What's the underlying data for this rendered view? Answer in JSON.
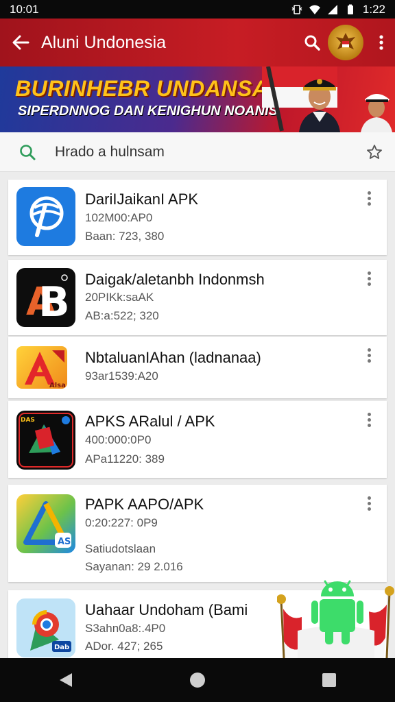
{
  "status_bar": {
    "time": "10:01",
    "clock": "1:22"
  },
  "app_bar": {
    "title": "Aluni Undonesia"
  },
  "banner": {
    "headline": "BURINHEBR UNDANSA!",
    "subtitle": "SIPERDNNOG DAN KENIGHUN NOANIS"
  },
  "search": {
    "text": "Hrado a hulnsam"
  },
  "apps": [
    {
      "name": "DariIJaikanI APK",
      "meta1": "102M00:AP0",
      "meta2": "Baan: 723, 380"
    },
    {
      "name": "Daigak/aletanbh Indonmsh",
      "meta1": "20PIKk:saAK",
      "meta2": "AB:a:522; 320"
    },
    {
      "name": "NbtaluanIAhan (ladnanaa)",
      "meta1": "93ar1539:A20"
    },
    {
      "name": "APKS ARalul / APK",
      "meta1": "400:000:0P0",
      "meta2": "APa11220: 389"
    },
    {
      "name": "PAPK AAPO/APK",
      "meta1": "0:20:227: 0P9",
      "meta2": "Satiudotslaan",
      "meta3": "Sayanan: 29 2.016"
    },
    {
      "name": "Uahaar Undoham (Bami",
      "meta1": "S3ahn0a8:.4P0",
      "meta2": "ADor. 427; 265"
    }
  ],
  "colors": {
    "app_bar": "#c71d24",
    "accent_green": "#2e9c5a",
    "nav_bar": "#0a0a0a"
  }
}
